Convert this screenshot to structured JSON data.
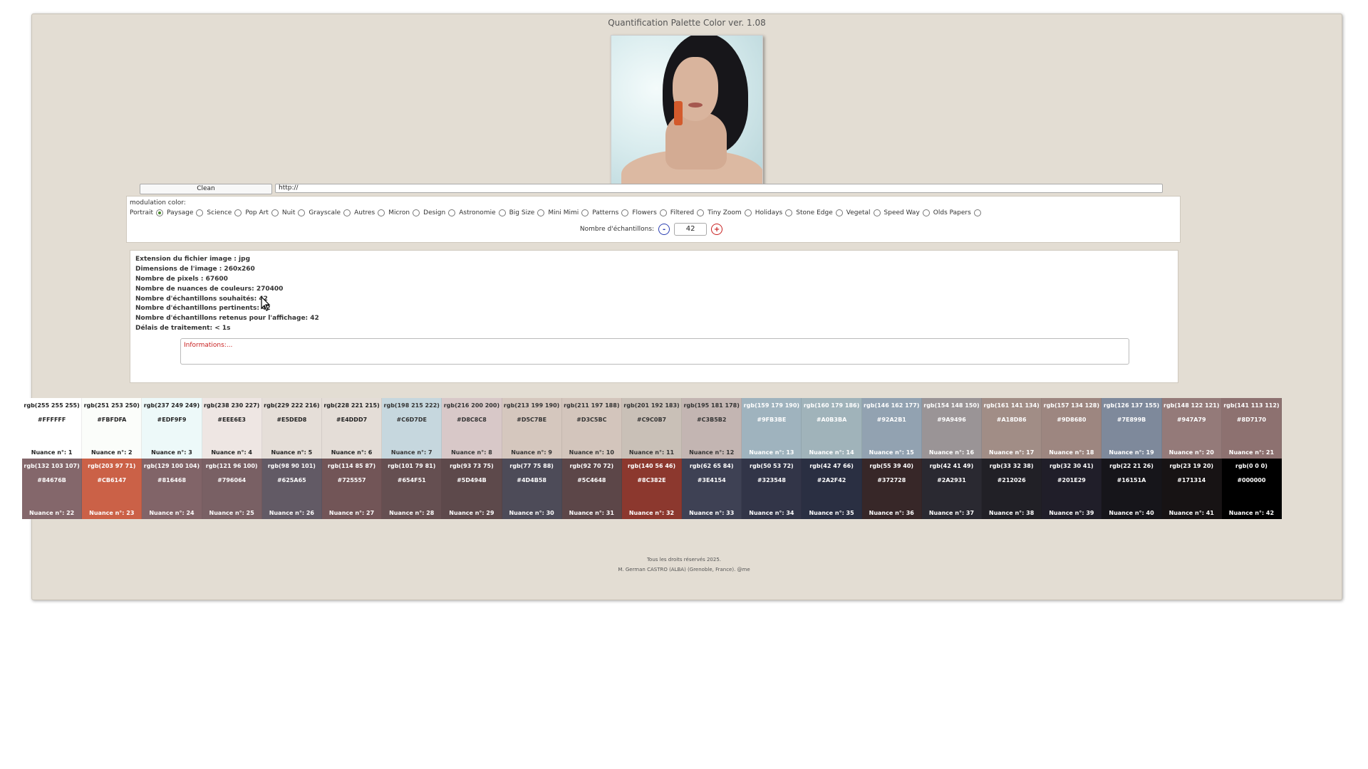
{
  "app": {
    "title": "Quantification Palette Color ver. 1.08"
  },
  "toolbar": {
    "clean_label": "Clean",
    "url_value": "http://"
  },
  "modulation": {
    "label": "modulation color:",
    "options": [
      "Portrait",
      "Paysage",
      "Science",
      "Pop Art",
      "Nuit",
      "Grayscale",
      "Autres",
      "Micron",
      "Design",
      "Astronomie",
      "Big Size",
      "Mini Mimi",
      "Patterns",
      "Flowers",
      "Filtered",
      "Tiny Zoom",
      "Holidays",
      "Stone Edge",
      "Vegetal",
      "Speed Way",
      "Olds Papers"
    ],
    "selected": "Portrait",
    "samples_label": "Nombre d'échantillons:",
    "minus_label": "-",
    "plus_label": "+",
    "samples_value": "42"
  },
  "info": {
    "lines": [
      "Extension du fichier image : jpg",
      "Dimensions de l'image : 260x260",
      "Nombre de pixels : 67600",
      "Nombre de nuances de couleurs: 270400",
      "Nombre d'échantillons souhaités: 42",
      "Nombre d'échantillons pertinents: 42",
      "Nombre d'échantillons retenus pour l'affichage: 42",
      "Délais de traitement: < 1s"
    ],
    "informations_label": "Informations:..."
  },
  "palette": [
    {
      "rgb": "rgb(255 255 255)",
      "hex": "#FFFFFF",
      "label": "Nuance n°: 1",
      "text": "#222222"
    },
    {
      "rgb": "rgb(251 253 250)",
      "hex": "#FBFDFA",
      "label": "Nuance n°: 2",
      "text": "#222222"
    },
    {
      "rgb": "rgb(237 249 249)",
      "hex": "#EDF9F9",
      "label": "Nuance n°: 3",
      "text": "#222222"
    },
    {
      "rgb": "rgb(238 230 227)",
      "hex": "#EEE6E3",
      "label": "Nuance n°: 4",
      "text": "#222222"
    },
    {
      "rgb": "rgb(229 222 216)",
      "hex": "#E5DED8",
      "label": "Nuance n°: 5",
      "text": "#222222"
    },
    {
      "rgb": "rgb(228 221 215)",
      "hex": "#E4DDD7",
      "label": "Nuance n°: 6",
      "text": "#222222"
    },
    {
      "rgb": "rgb(198 215 222)",
      "hex": "#C6D7DE",
      "label": "Nuance n°: 7",
      "text": "#333333"
    },
    {
      "rgb": "rgb(216 200 200)",
      "hex": "#D8C8C8",
      "label": "Nuance n°: 8",
      "text": "#333333"
    },
    {
      "rgb": "rgb(213 199 190)",
      "hex": "#D5C7BE",
      "label": "Nuance n°: 9",
      "text": "#333333"
    },
    {
      "rgb": "rgb(211 197 188)",
      "hex": "#D3C5BC",
      "label": "Nuance n°: 10",
      "text": "#333333"
    },
    {
      "rgb": "rgb(201 192 183)",
      "hex": "#C9C0B7",
      "label": "Nuance n°: 11",
      "text": "#333333"
    },
    {
      "rgb": "rgb(195 181 178)",
      "hex": "#C3B5B2",
      "label": "Nuance n°: 12",
      "text": "#333333"
    },
    {
      "rgb": "rgb(159 179 190)",
      "hex": "#9FB3BE",
      "label": "Nuance n°: 13",
      "text": "#ffffff"
    },
    {
      "rgb": "rgb(160 179 186)",
      "hex": "#A0B3BA",
      "label": "Nuance n°: 14",
      "text": "#ffffff"
    },
    {
      "rgb": "rgb(146 162 177)",
      "hex": "#92A2B1",
      "label": "Nuance n°: 15",
      "text": "#ffffff"
    },
    {
      "rgb": "rgb(154 148 150)",
      "hex": "#9A9496",
      "label": "Nuance n°: 16",
      "text": "#ffffff"
    },
    {
      "rgb": "rgb(161 141 134)",
      "hex": "#A18D86",
      "label": "Nuance n°: 17",
      "text": "#ffffff"
    },
    {
      "rgb": "rgb(157 134 128)",
      "hex": "#9D8680",
      "label": "Nuance n°: 18",
      "text": "#ffffff"
    },
    {
      "rgb": "rgb(126 137 155)",
      "hex": "#7E899B",
      "label": "Nuance n°: 19",
      "text": "#ffffff"
    },
    {
      "rgb": "rgb(148 122 121)",
      "hex": "#947A79",
      "label": "Nuance n°: 20",
      "text": "#ffffff"
    },
    {
      "rgb": "rgb(141 113 112)",
      "hex": "#8D7170",
      "label": "Nuance n°: 21",
      "text": "#ffffff"
    },
    {
      "rgb": "rgb(132 103 107)",
      "hex": "#84676B",
      "label": "Nuance n°: 22",
      "text": "#ffffff"
    },
    {
      "rgb": "rgb(203 97 71)",
      "hex": "#CB6147",
      "label": "Nuance n°: 23",
      "text": "#ffffff"
    },
    {
      "rgb": "rgb(129 100 104)",
      "hex": "#816468",
      "label": "Nuance n°: 24",
      "text": "#ffffff"
    },
    {
      "rgb": "rgb(121 96 100)",
      "hex": "#796064",
      "label": "Nuance n°: 25",
      "text": "#ffffff"
    },
    {
      "rgb": "rgb(98 90 101)",
      "hex": "#625A65",
      "label": "Nuance n°: 26",
      "text": "#ffffff"
    },
    {
      "rgb": "rgb(114 85 87)",
      "hex": "#725557",
      "label": "Nuance n°: 27",
      "text": "#ffffff"
    },
    {
      "rgb": "rgb(101 79 81)",
      "hex": "#654F51",
      "label": "Nuance n°: 28",
      "text": "#ffffff"
    },
    {
      "rgb": "rgb(93 73 75)",
      "hex": "#5D494B",
      "label": "Nuance n°: 29",
      "text": "#ffffff"
    },
    {
      "rgb": "rgb(77 75 88)",
      "hex": "#4D4B58",
      "label": "Nuance n°: 30",
      "text": "#ffffff"
    },
    {
      "rgb": "rgb(92 70 72)",
      "hex": "#5C4648",
      "label": "Nuance n°: 31",
      "text": "#ffffff"
    },
    {
      "rgb": "rgb(140 56 46)",
      "hex": "#8C382E",
      "label": "Nuance n°: 32",
      "text": "#ffffff"
    },
    {
      "rgb": "rgb(62 65 84)",
      "hex": "#3E4154",
      "label": "Nuance n°: 33",
      "text": "#ffffff"
    },
    {
      "rgb": "rgb(50 53 72)",
      "hex": "#323548",
      "label": "Nuance n°: 34",
      "text": "#ffffff"
    },
    {
      "rgb": "rgb(42 47 66)",
      "hex": "#2A2F42",
      "label": "Nuance n°: 35",
      "text": "#ffffff"
    },
    {
      "rgb": "rgb(55 39 40)",
      "hex": "#372728",
      "label": "Nuance n°: 36",
      "text": "#ffffff"
    },
    {
      "rgb": "rgb(42 41 49)",
      "hex": "#2A2931",
      "label": "Nuance n°: 37",
      "text": "#ffffff"
    },
    {
      "rgb": "rgb(33 32 38)",
      "hex": "#212026",
      "label": "Nuance n°: 38",
      "text": "#ffffff"
    },
    {
      "rgb": "rgb(32 30 41)",
      "hex": "#201E29",
      "label": "Nuance n°: 39",
      "text": "#ffffff"
    },
    {
      "rgb": "rgb(22 21 26)",
      "hex": "#16151A",
      "label": "Nuance n°: 40",
      "text": "#ffffff"
    },
    {
      "rgb": "rgb(23 19 20)",
      "hex": "#171314",
      "label": "Nuance n°: 41",
      "text": "#ffffff"
    },
    {
      "rgb": "rgb(0 0 0)",
      "hex": "#000000",
      "label": "Nuance n°: 42",
      "text": "#ffffff"
    }
  ],
  "footer": {
    "copyright": "Tous les droits réservés 2025.",
    "author": "M. German CASTRO (ALBA) (Grenoble, France). @me"
  }
}
